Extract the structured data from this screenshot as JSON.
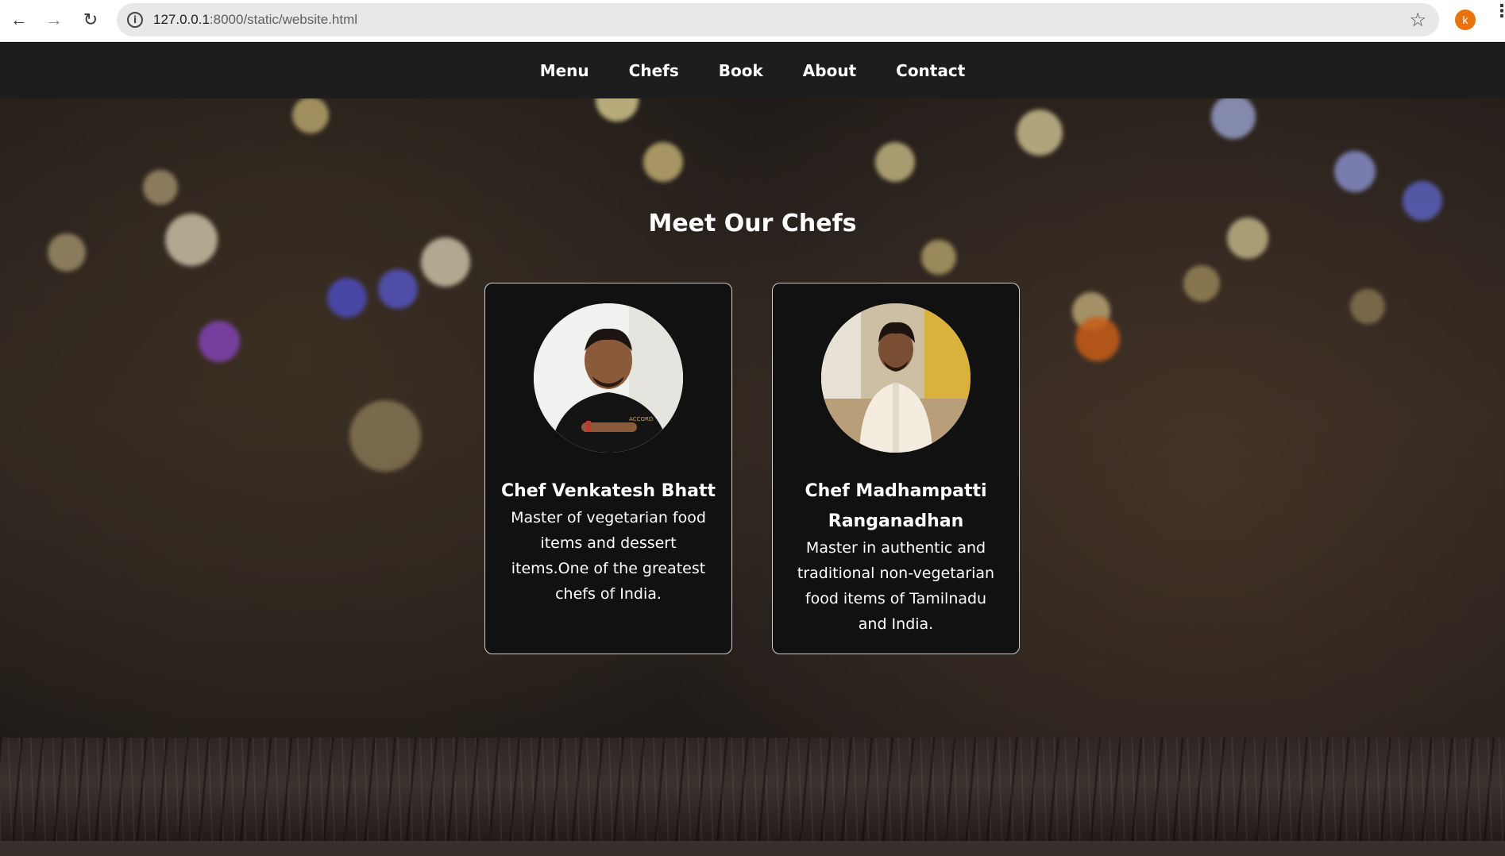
{
  "browser": {
    "url_host": "127.0.0.1",
    "url_path": ":8000/static/website.html",
    "profile_initial": "k"
  },
  "nav": {
    "items": [
      "Menu",
      "Chefs",
      "Book",
      "About",
      "Contact"
    ]
  },
  "chefs_section": {
    "title": "Meet Our Chefs",
    "chefs": [
      {
        "name": "Chef Venkatesh Bhatt",
        "description": "Master of vegetarian food items and dessert items.One of the greatest chefs of India."
      },
      {
        "name": "Chef Madhampatti Ranganadhan",
        "description": "Master in authentic and traditional non-vegetarian food items of Tamilnadu and India."
      }
    ]
  },
  "colors": {
    "nav_bg": "#1d1d1d",
    "card_bg": "#111111",
    "avatar": "#e8730c"
  }
}
